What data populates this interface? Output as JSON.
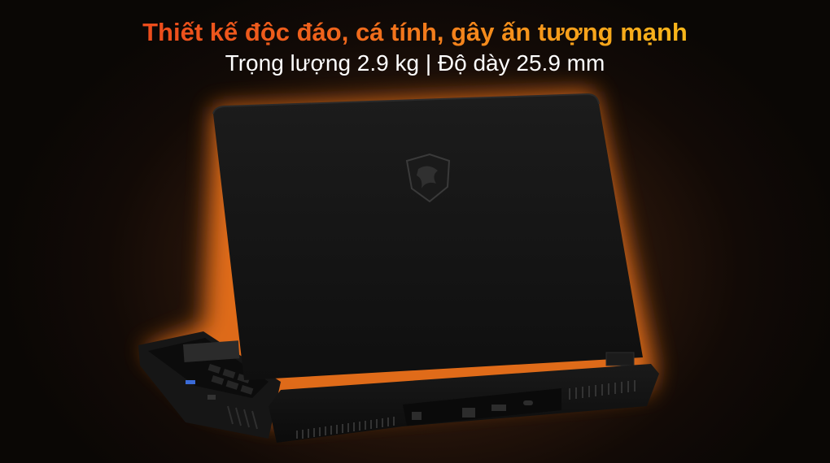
{
  "headline": "Thiết kế độc đáo, cá tính, gây ấn tượng mạnh",
  "subline": "Trọng lượng 2.9 kg | Độ dày 25.9 mm",
  "colors": {
    "headline_gradient_start": "#e83a1c",
    "headline_gradient_end": "#f8d21a",
    "subline": "#ffffff",
    "glow": "#ff7a1e",
    "chassis": "#151515"
  },
  "product": {
    "logo_icon": "msi-dragon-shield-icon"
  }
}
